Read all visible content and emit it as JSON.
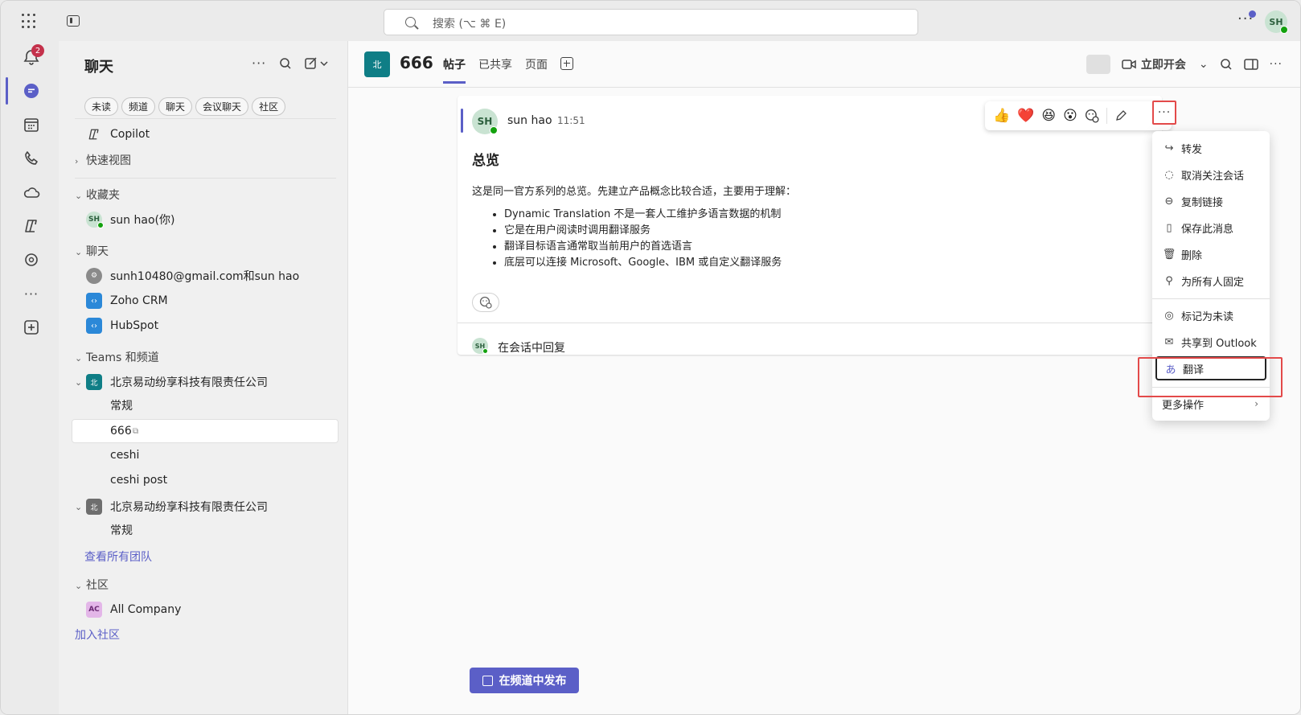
{
  "titlebar": {
    "search_placeholder": "搜索 (⌥ ⌘ E)",
    "more": "···",
    "avatar_initials": "SH"
  },
  "rail": {
    "notification_count": "2"
  },
  "chatlist": {
    "title": "聊天",
    "filters": [
      "未读",
      "频道",
      "聊天",
      "会议聊天",
      "社区"
    ],
    "copilot": "Copilot",
    "quick_views": "快速视图",
    "favorites_header": "收藏夹",
    "favorite_user": "sun hao(你)",
    "favorite_user_initials": "SH",
    "chats_header": "聊天",
    "chats": [
      {
        "label": "sunh10480@gmail.com和sun hao"
      },
      {
        "label": "Zoho CRM"
      },
      {
        "label": "HubSpot"
      }
    ],
    "teams_header": "Teams 和频道",
    "team1": "北京易动纷享科技有限责任公司",
    "team1_tile": "北",
    "team1_channels": [
      "常规",
      "666",
      "ceshi",
      "ceshi post"
    ],
    "team2": "北京易动纷享科技有限责任公司",
    "team2_tile": "北",
    "team2_channels": [
      "常规"
    ],
    "see_all_teams": "查看所有团队",
    "community_header": "社区",
    "community": "All Company",
    "community_initials": "AC",
    "join_community": "加入社区"
  },
  "main": {
    "team_tile": "北",
    "channel_name": "666",
    "tabs": [
      "帖子",
      "已共享",
      "页面"
    ],
    "meet_now": "立即开会",
    "post": {
      "author": "sun hao",
      "author_initials": "SH",
      "time": "11:51",
      "title": "总览",
      "intro": "这是同一官方系列的总览。先建立产品概念比较合适，主要用于理解：",
      "bullets": [
        "Dynamic Translation 不是一套人工维护多语言数据的机制",
        "它是在用户阅读时调用翻译服务",
        "翻译目标语言通常取当前用户的首选语言",
        "底层可以连接 Microsoft、Google、IBM 或自定义翻译服务"
      ],
      "reply_label": "在会话中回复",
      "reply_initials": "SH"
    },
    "reactions": [
      "👍",
      "❤️",
      "😆",
      "😮"
    ],
    "more_actions": "···",
    "menu": {
      "items": [
        "转发",
        "取消关注会话",
        "复制链接",
        "保存此消息",
        "删除",
        "为所有人固定",
        "标记为未读",
        "共享到 Outlook",
        "翻译",
        "更多操作"
      ]
    },
    "post_button": "在频道中发布"
  },
  "colors": {
    "accent": "#5b5fc7",
    "highlight": "#e34a4a",
    "presence": "#13a10e"
  }
}
